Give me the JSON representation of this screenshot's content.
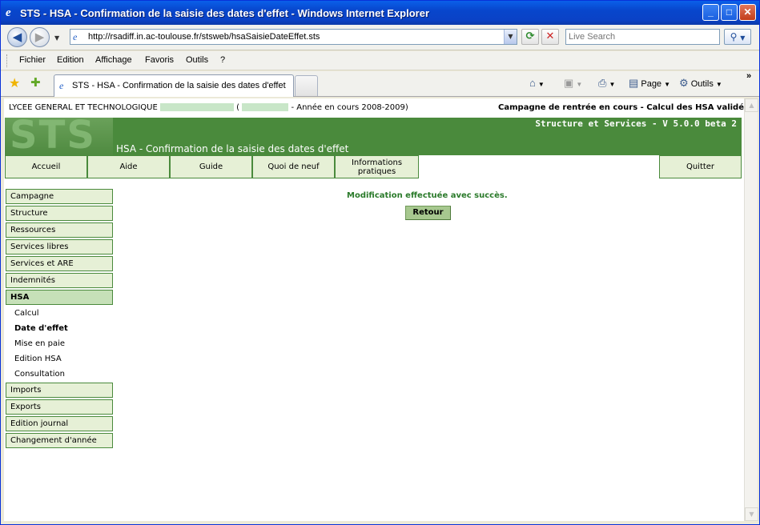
{
  "window": {
    "title": "STS - HSA - Confirmation de la saisie des dates d'effet - Windows Internet Explorer",
    "minimize": "_",
    "maximize": "□",
    "close": "✕"
  },
  "address": {
    "url": "http://rsadiff.in.ac-toulouse.fr/stsweb/hsaSaisieDateEffet.sts",
    "search_placeholder": "Live Search"
  },
  "menu": [
    "Fichier",
    "Edition",
    "Affichage",
    "Favoris",
    "Outils",
    "?"
  ],
  "tab": {
    "label": "STS - HSA - Confirmation de la saisie des dates d'effet"
  },
  "commands": {
    "page": "Page",
    "tools": "Outils"
  },
  "page": {
    "school_prefix": "LYCEE GENERAL ET TECHNOLOGIQUE",
    "school_open_paren": "(",
    "school_year": "- Année en cours 2008-2009)",
    "campaign": "Campagne de rentrée en cours - Calcul des HSA validé",
    "logo": "STS",
    "version": "Structure et Services - V 5.0.0 beta 2",
    "title": "HSA - Confirmation de la saisie des dates d'effet"
  },
  "topnav": {
    "accueil": "Accueil",
    "aide": "Aide",
    "guide": "Guide",
    "quoi_de_neuf": "Quoi de neuf",
    "info_line1": "Informations",
    "info_line2": "pratiques",
    "quitter": "Quitter"
  },
  "sidebar": {
    "campagne": "Campagne",
    "structure": "Structure",
    "ressources": "Ressources",
    "services_libres": "Services libres",
    "services_are": "Services et ARE",
    "indemnites": "Indemnités",
    "hsa": "HSA",
    "hsa_sub": {
      "calcul": "Calcul",
      "date_effet": "Date d'effet",
      "mise_en_paie": "Mise en paie",
      "edition_hsa": "Edition HSA",
      "consultation": "Consultation"
    },
    "imports": "Imports",
    "exports": "Exports",
    "edition_journal": "Edition journal",
    "changement_annee": "Changement d'année"
  },
  "main": {
    "success": "Modification effectuée avec succès.",
    "retour": "Retour"
  }
}
